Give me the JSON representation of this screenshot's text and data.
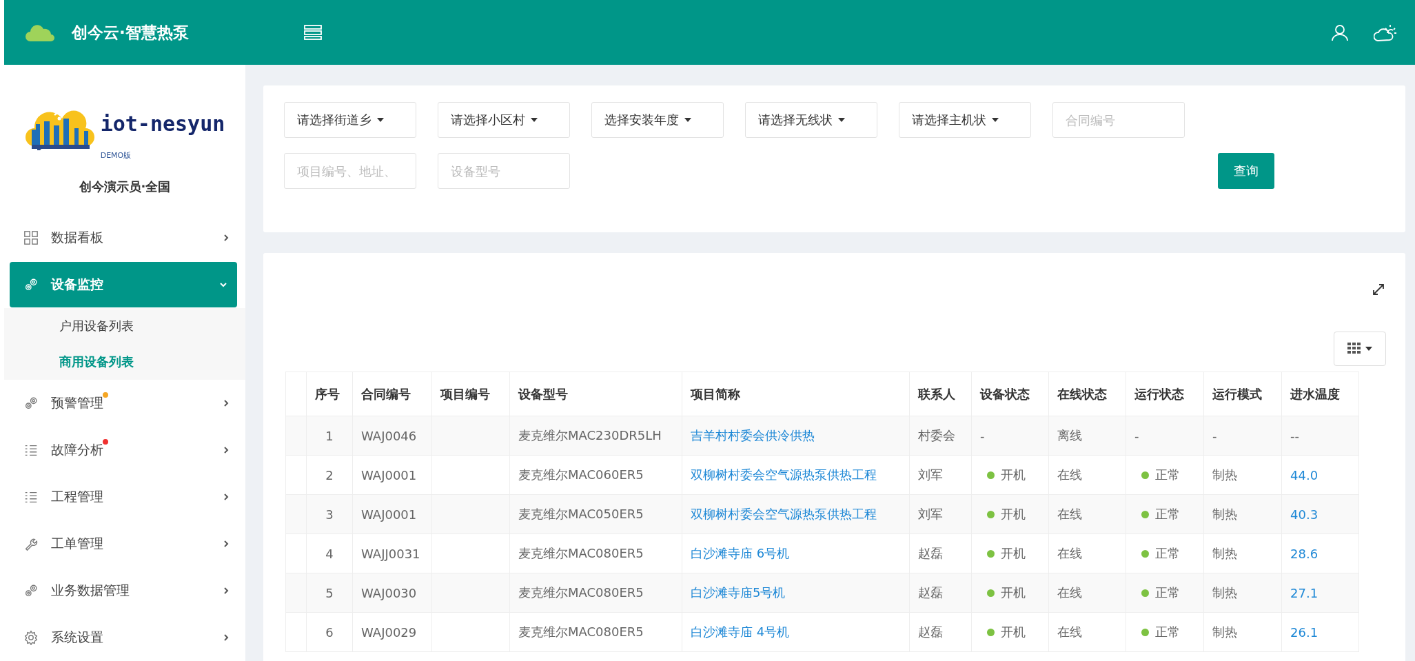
{
  "header": {
    "title": "创今云·智慧热泵"
  },
  "sidebar": {
    "logo_text": "iot-nesyun",
    "logo_sub": "DEMO版",
    "user": "创今演示员·全国",
    "items": [
      {
        "kind": "grid",
        "label": "数据看板",
        "expanded": false,
        "selected": false
      },
      {
        "kind": "gears",
        "label": "设备监控",
        "expanded": true,
        "selected": true,
        "children": [
          {
            "label": "户用设备列表",
            "selected": false
          },
          {
            "label": "商用设备列表",
            "selected": true
          }
        ]
      },
      {
        "kind": "gears",
        "label": "预警管理",
        "expanded": false,
        "selected": false,
        "color": "#f5a623"
      },
      {
        "kind": "list",
        "label": "故障分析",
        "expanded": false,
        "selected": false,
        "color": "#f0302f"
      },
      {
        "kind": "list",
        "label": "工程管理",
        "expanded": false,
        "selected": false
      },
      {
        "kind": "wrench",
        "label": "工单管理",
        "expanded": false,
        "selected": false
      },
      {
        "kind": "gears",
        "label": "业务数据管理",
        "expanded": false,
        "selected": false
      },
      {
        "kind": "gear",
        "label": "系统设置",
        "expanded": false,
        "selected": false
      }
    ]
  },
  "filters": [
    {
      "kind": "select",
      "value": "请选择街道乡"
    },
    {
      "kind": "select",
      "value": "请选择小区村"
    },
    {
      "kind": "select",
      "value": "选择安装年度"
    },
    {
      "kind": "select",
      "value": "请选择无线状"
    },
    {
      "kind": "select",
      "value": "请选择主机状"
    },
    {
      "kind": "input",
      "placeholder": "合同编号"
    },
    {
      "kind": "input",
      "placeholder": "项目编号、地址、"
    },
    {
      "kind": "input",
      "placeholder": "设备型号"
    }
  ],
  "search_button": "查询",
  "table": {
    "columns": [
      "序号",
      "合同编号",
      "项目编号",
      "设备型号",
      "项目简称",
      "联系人",
      "设备状态",
      "在线状态",
      "运行状态",
      "运行模式",
      "进水温度"
    ],
    "rows": [
      {
        "no": "1",
        "contract": "WAJ0046",
        "project_no": "",
        "model": "麦克维尔MAC230DR5LH",
        "project": "吉羊村村委会供冷供热",
        "contact": "村委会",
        "device_status": "-",
        "device_on": false,
        "online": "离线",
        "run_status": "-",
        "run_ok": false,
        "mode": "-",
        "inlet_temp": "--"
      },
      {
        "no": "2",
        "contract": "WAJ0001",
        "project_no": "",
        "model": "麦克维尔MAC060ER5",
        "project": "双柳树村委会空气源热泵供热工程",
        "contact": "刘军",
        "device_status": "开机",
        "device_on": true,
        "online": "在线",
        "run_status": "正常",
        "run_ok": true,
        "mode": "制热",
        "inlet_temp": "44.0"
      },
      {
        "no": "3",
        "contract": "WAJ0001",
        "project_no": "",
        "model": "麦克维尔MAC050ER5",
        "project": "双柳树村委会空气源热泵供热工程",
        "contact": "刘军",
        "device_status": "开机",
        "device_on": true,
        "online": "在线",
        "run_status": "正常",
        "run_ok": true,
        "mode": "制热",
        "inlet_temp": "40.3"
      },
      {
        "no": "4",
        "contract": "WAJJ0031",
        "project_no": "",
        "model": "麦克维尔MAC080ER5",
        "project": "白沙滩寺庙 6号机",
        "contact": "赵磊",
        "device_status": "开机",
        "device_on": true,
        "online": "在线",
        "run_status": "正常",
        "run_ok": true,
        "mode": "制热",
        "inlet_temp": "28.6"
      },
      {
        "no": "5",
        "contract": "WAJ0030",
        "project_no": "",
        "model": "麦克维尔MAC080ER5",
        "project": "白沙滩寺庙5号机",
        "contact": "赵磊",
        "device_status": "开机",
        "device_on": true,
        "online": "在线",
        "run_status": "正常",
        "run_ok": true,
        "mode": "制热",
        "inlet_temp": "27.1"
      },
      {
        "no": "6",
        "contract": "WAJ0029",
        "project_no": "",
        "model": "麦克维尔MAC080ER5",
        "project": "白沙滩寺庙 4号机",
        "contact": "赵磊",
        "device_status": "开机",
        "device_on": true,
        "online": "在线",
        "run_status": "正常",
        "run_ok": true,
        "mode": "制热",
        "inlet_temp": "26.1"
      }
    ]
  }
}
